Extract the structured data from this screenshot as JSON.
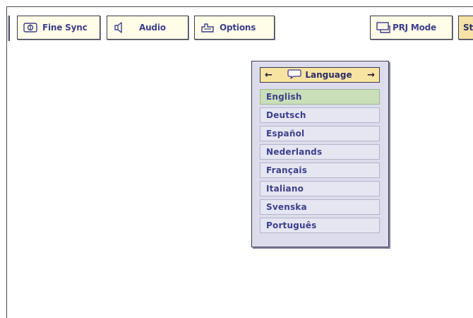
{
  "toolbar": {
    "tabs": [
      {
        "label": "Fine Sync",
        "icon": "fine-sync-icon"
      },
      {
        "label": "Audio",
        "icon": "speaker-icon"
      },
      {
        "label": "Options",
        "icon": "options-icon"
      },
      {
        "label": "PRJ Mode",
        "icon": "prj-mode-icon"
      },
      {
        "label": "St",
        "icon": ""
      }
    ]
  },
  "language_menu": {
    "title": "Language",
    "left_arrow": "←",
    "right_arrow": "→",
    "selected": "English",
    "items": [
      "English",
      "Deutsch",
      "Español",
      "Nederlands",
      "Français",
      "Italiano",
      "Svenska",
      "Português"
    ]
  },
  "colors": {
    "tab_bg": "#fffde8",
    "tab_text": "#3d3f8c",
    "menu_bg": "#dcdcec",
    "title_bg": "#f8e4a2",
    "selected_bg": "#c9dfb9"
  }
}
